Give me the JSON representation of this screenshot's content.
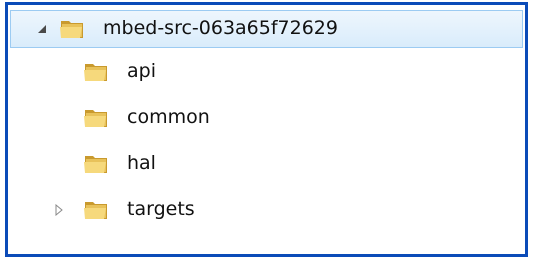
{
  "tree": {
    "root": {
      "label": "mbed-src-063a65f72629",
      "icon": "folder-icon",
      "expander": "expanded-arrow-icon",
      "selected": true
    },
    "children": [
      {
        "label": "api",
        "icon": "folder-icon",
        "has_children": false
      },
      {
        "label": "common",
        "icon": "folder-icon",
        "has_children": false
      },
      {
        "label": "hal",
        "icon": "folder-icon",
        "has_children": false
      },
      {
        "label": "targets",
        "icon": "folder-icon",
        "has_children": true,
        "expander": "collapsed-arrow-icon"
      }
    ]
  },
  "colors": {
    "frame_border": "#0b4bb8",
    "selection_fill": "#d9ecfb",
    "selection_border": "#9ccbf2",
    "folder_body": "#e8c25a",
    "folder_front": "#f6d97c",
    "folder_shadow": "#c99a2e"
  }
}
